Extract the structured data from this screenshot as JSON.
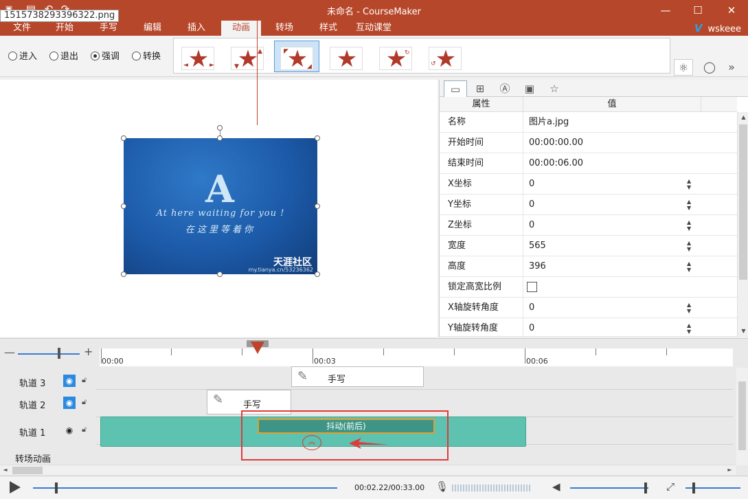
{
  "window": {
    "title": "未命名 - CourseMaker",
    "tooltip_filename": "1515738293396322.png",
    "minimize": "—",
    "maximize": "☐",
    "close": "✕"
  },
  "menu": {
    "items": [
      "文件",
      "开始",
      "手写",
      "编辑",
      "插入",
      "动画",
      "转场",
      "样式",
      "互动课堂"
    ],
    "active": "动画",
    "username": "wskeee",
    "user_logo": "V"
  },
  "ribbon": {
    "radios": [
      {
        "label": "进入",
        "checked": false
      },
      {
        "label": "退出",
        "checked": false
      },
      {
        "label": "强调",
        "checked": true
      },
      {
        "label": "转换",
        "checked": false
      }
    ],
    "effects_count_selected": 2
  },
  "canvas": {
    "image": {
      "letter": "A",
      "line1": "At here waiting for you !",
      "line2": "在这里等着你",
      "brand": "天涯社区",
      "url": "my.tianya.cn/53236362"
    }
  },
  "properties": {
    "header": {
      "key": "属性",
      "value": "值"
    },
    "rows": [
      {
        "key": "名称",
        "value": "图片a.jpg",
        "spin": false
      },
      {
        "key": "开始时间",
        "value": "00:00:00.00",
        "spin": false
      },
      {
        "key": "结束时间",
        "value": "00:00:06.00",
        "spin": false
      },
      {
        "key": "X坐标",
        "value": "0",
        "spin": true
      },
      {
        "key": "Y坐标",
        "value": "0",
        "spin": true
      },
      {
        "key": "Z坐标",
        "value": "0",
        "spin": true
      },
      {
        "key": "宽度",
        "value": "565",
        "spin": true
      },
      {
        "key": "高度",
        "value": "396",
        "spin": true
      },
      {
        "key": "锁定高宽比例",
        "value": "",
        "checkbox": true
      },
      {
        "key": "X轴旋转角度",
        "value": "0",
        "spin": true
      },
      {
        "key": "Y轴旋转角度",
        "value": "0",
        "spin": true
      }
    ]
  },
  "timeline": {
    "ruler_labels": [
      "00:00",
      "00:03",
      "00:06"
    ],
    "tracks": [
      {
        "name": "轨道 3",
        "eye": "hidden"
      },
      {
        "name": "轨道 2",
        "eye": "hidden"
      },
      {
        "name": "轨道 1",
        "eye": "visible"
      }
    ],
    "transition_row": "转场动画",
    "clips": {
      "track3": "手写",
      "track2": "手写",
      "effect": "抖动(前后)"
    }
  },
  "player": {
    "time": "00:02.22/00:33.00"
  },
  "colors": {
    "brand": "#b7472a",
    "clip": "#5ec2b0",
    "accent": "#3a7bd5",
    "highlight": "#e03a3a"
  }
}
